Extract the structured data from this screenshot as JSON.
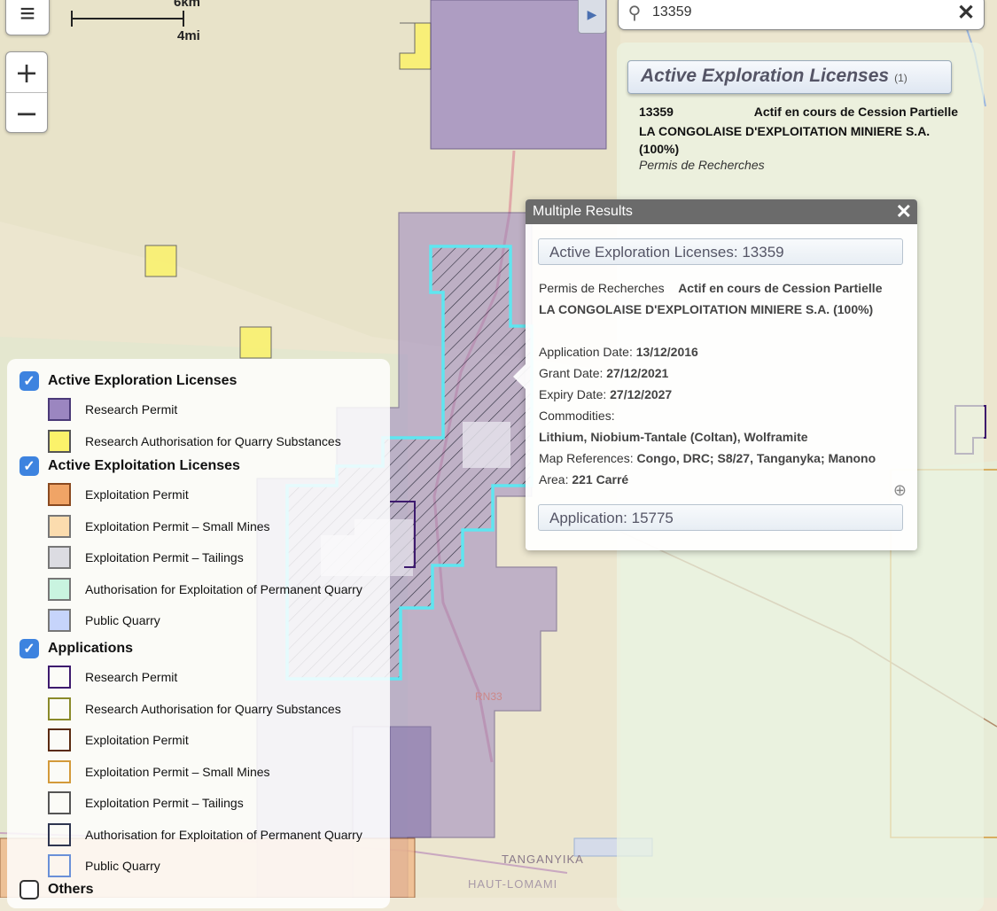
{
  "map": {
    "scale": {
      "km": "6km",
      "mi": "4mi"
    },
    "labels": {
      "road": "RN33",
      "province": "TANGANYIKA",
      "province2": "HAUT-LOMAMI"
    }
  },
  "controls": {
    "menu_icon": "hamburger-icon",
    "zoom_in": "+",
    "zoom_out": "−"
  },
  "search": {
    "query": "13359",
    "search_icon": "search-icon",
    "clear": "✕",
    "toggle": "▶"
  },
  "results_panel": {
    "title": "Active Exploration Licenses",
    "count": "(1)",
    "item": {
      "code": "13359",
      "status": "Actif en cours de Cession Partielle",
      "holder": "LA CONGOLAISE D'EXPLOITATION MINIERE S.A. (100%)",
      "type": "Permis de Recherches"
    }
  },
  "popup": {
    "title": "Multiple Results",
    "close": "✕",
    "section1": "Active Exploration Licenses: 13359",
    "type": "Permis de Recherches",
    "status": "Actif en cours de Cession Partielle",
    "holder": "LA CONGOLAISE D'EXPLOITATION MINIERE S.A. (100%)",
    "application_date_label": "Application Date:",
    "application_date": "13/12/2016",
    "grant_date_label": "Grant Date:",
    "grant_date": "27/12/2021",
    "expiry_date_label": "Expiry Date:",
    "expiry_date": "27/12/2027",
    "commodities_label": "Commodities:",
    "commodities": "Lithium, Niobium-Tantale (Coltan), Wolframite",
    "map_refs_label": "Map References:",
    "map_refs": "Congo, DRC; S8/27, Tanganyka; Manono",
    "area_label": "Area:",
    "area": "221 Carré",
    "section2": "Application: 15775"
  },
  "legend": {
    "groups": [
      {
        "title": "Active Exploration Licenses",
        "checked": true,
        "items": [
          {
            "label": "Research Permit",
            "fill": "#9b86c0",
            "stroke": "#4b3a78"
          },
          {
            "label": "Research Authorisation for Quarry Substances",
            "fill": "#fbf26a",
            "stroke": "#555"
          }
        ]
      },
      {
        "title": "Active Exploitation Licenses",
        "checked": true,
        "items": [
          {
            "label": "Exploitation Permit",
            "fill": "#f0a466",
            "stroke": "#8a4a20"
          },
          {
            "label": "Exploitation Permit – Small Mines",
            "fill": "#fbdcae",
            "stroke": "#777"
          },
          {
            "label": "Exploitation Permit – Tailings",
            "fill": "#dcdce2",
            "stroke": "#777"
          },
          {
            "label": "Authorisation for Exploitation of Permanent Quarry",
            "fill": "#c9f4e0",
            "stroke": "#777"
          },
          {
            "label": "Public Quarry",
            "fill": "#c6d4fb",
            "stroke": "#777"
          }
        ]
      },
      {
        "title": "Applications",
        "checked": true,
        "items": [
          {
            "label": "Research Permit",
            "fill": "transparent",
            "stroke": "#3d1a6e"
          },
          {
            "label": "Research Authorisation for Quarry Substances",
            "fill": "transparent",
            "stroke": "#8a8a2a"
          },
          {
            "label": "Exploitation Permit",
            "fill": "transparent",
            "stroke": "#5a2a10"
          },
          {
            "label": "Exploitation Permit – Small Mines",
            "fill": "transparent",
            "stroke": "#d39a3a"
          },
          {
            "label": "Exploitation Permit – Tailings",
            "fill": "transparent",
            "stroke": "#555"
          },
          {
            "label": "Authorisation for Exploitation of Permanent Quarry",
            "fill": "transparent",
            "stroke": "#2e3550"
          },
          {
            "label": "Public Quarry",
            "fill": "transparent",
            "stroke": "#6a90d8"
          }
        ]
      },
      {
        "title": "Others",
        "checked": false,
        "items": []
      }
    ]
  },
  "colors": {
    "accent": "#3d83df",
    "permit_fill": "#9b86c0",
    "highlight": "#5fe6f0"
  }
}
